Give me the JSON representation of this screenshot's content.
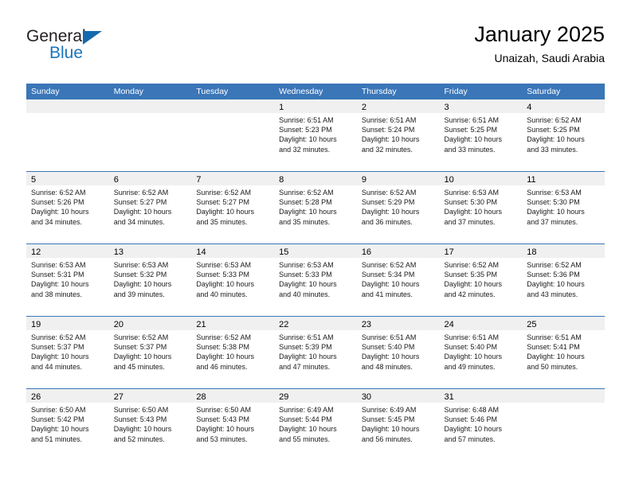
{
  "brand": {
    "name_top": "General",
    "name_bottom": "Blue",
    "triangle_color": "#156aad",
    "blue_color": "#1b75bb"
  },
  "header": {
    "title": "January 2025",
    "subtitle": "Unaizah, Saudi Arabia"
  },
  "colors": {
    "header_row": "#3A76B8",
    "daynum_band": "#f0f0f0",
    "text": "#000000"
  },
  "weekday_headers": [
    "Sunday",
    "Monday",
    "Tuesday",
    "Wednesday",
    "Thursday",
    "Friday",
    "Saturday"
  ],
  "labels": {
    "sunrise_prefix": "Sunrise:",
    "sunset_prefix": "Sunset:",
    "daylight_prefix": "Daylight:"
  },
  "weeks": [
    [
      {
        "day": "",
        "empty": true,
        "sunrise": "",
        "sunset": "",
        "daylight_line1": "",
        "daylight_line2": ""
      },
      {
        "day": "",
        "empty": true,
        "sunrise": "",
        "sunset": "",
        "daylight_line1": "",
        "daylight_line2": ""
      },
      {
        "day": "",
        "empty": true,
        "sunrise": "",
        "sunset": "",
        "daylight_line1": "",
        "daylight_line2": ""
      },
      {
        "day": "1",
        "empty": false,
        "sunrise": "Sunrise: 6:51 AM",
        "sunset": "Sunset: 5:23 PM",
        "daylight_line1": "Daylight: 10 hours",
        "daylight_line2": "and 32 minutes."
      },
      {
        "day": "2",
        "empty": false,
        "sunrise": "Sunrise: 6:51 AM",
        "sunset": "Sunset: 5:24 PM",
        "daylight_line1": "Daylight: 10 hours",
        "daylight_line2": "and 32 minutes."
      },
      {
        "day": "3",
        "empty": false,
        "sunrise": "Sunrise: 6:51 AM",
        "sunset": "Sunset: 5:25 PM",
        "daylight_line1": "Daylight: 10 hours",
        "daylight_line2": "and 33 minutes."
      },
      {
        "day": "4",
        "empty": false,
        "sunrise": "Sunrise: 6:52 AM",
        "sunset": "Sunset: 5:25 PM",
        "daylight_line1": "Daylight: 10 hours",
        "daylight_line2": "and 33 minutes."
      }
    ],
    [
      {
        "day": "5",
        "empty": false,
        "sunrise": "Sunrise: 6:52 AM",
        "sunset": "Sunset: 5:26 PM",
        "daylight_line1": "Daylight: 10 hours",
        "daylight_line2": "and 34 minutes."
      },
      {
        "day": "6",
        "empty": false,
        "sunrise": "Sunrise: 6:52 AM",
        "sunset": "Sunset: 5:27 PM",
        "daylight_line1": "Daylight: 10 hours",
        "daylight_line2": "and 34 minutes."
      },
      {
        "day": "7",
        "empty": false,
        "sunrise": "Sunrise: 6:52 AM",
        "sunset": "Sunset: 5:27 PM",
        "daylight_line1": "Daylight: 10 hours",
        "daylight_line2": "and 35 minutes."
      },
      {
        "day": "8",
        "empty": false,
        "sunrise": "Sunrise: 6:52 AM",
        "sunset": "Sunset: 5:28 PM",
        "daylight_line1": "Daylight: 10 hours",
        "daylight_line2": "and 35 minutes."
      },
      {
        "day": "9",
        "empty": false,
        "sunrise": "Sunrise: 6:52 AM",
        "sunset": "Sunset: 5:29 PM",
        "daylight_line1": "Daylight: 10 hours",
        "daylight_line2": "and 36 minutes."
      },
      {
        "day": "10",
        "empty": false,
        "sunrise": "Sunrise: 6:53 AM",
        "sunset": "Sunset: 5:30 PM",
        "daylight_line1": "Daylight: 10 hours",
        "daylight_line2": "and 37 minutes."
      },
      {
        "day": "11",
        "empty": false,
        "sunrise": "Sunrise: 6:53 AM",
        "sunset": "Sunset: 5:30 PM",
        "daylight_line1": "Daylight: 10 hours",
        "daylight_line2": "and 37 minutes."
      }
    ],
    [
      {
        "day": "12",
        "empty": false,
        "sunrise": "Sunrise: 6:53 AM",
        "sunset": "Sunset: 5:31 PM",
        "daylight_line1": "Daylight: 10 hours",
        "daylight_line2": "and 38 minutes."
      },
      {
        "day": "13",
        "empty": false,
        "sunrise": "Sunrise: 6:53 AM",
        "sunset": "Sunset: 5:32 PM",
        "daylight_line1": "Daylight: 10 hours",
        "daylight_line2": "and 39 minutes."
      },
      {
        "day": "14",
        "empty": false,
        "sunrise": "Sunrise: 6:53 AM",
        "sunset": "Sunset: 5:33 PM",
        "daylight_line1": "Daylight: 10 hours",
        "daylight_line2": "and 40 minutes."
      },
      {
        "day": "15",
        "empty": false,
        "sunrise": "Sunrise: 6:53 AM",
        "sunset": "Sunset: 5:33 PM",
        "daylight_line1": "Daylight: 10 hours",
        "daylight_line2": "and 40 minutes."
      },
      {
        "day": "16",
        "empty": false,
        "sunrise": "Sunrise: 6:52 AM",
        "sunset": "Sunset: 5:34 PM",
        "daylight_line1": "Daylight: 10 hours",
        "daylight_line2": "and 41 minutes."
      },
      {
        "day": "17",
        "empty": false,
        "sunrise": "Sunrise: 6:52 AM",
        "sunset": "Sunset: 5:35 PM",
        "daylight_line1": "Daylight: 10 hours",
        "daylight_line2": "and 42 minutes."
      },
      {
        "day": "18",
        "empty": false,
        "sunrise": "Sunrise: 6:52 AM",
        "sunset": "Sunset: 5:36 PM",
        "daylight_line1": "Daylight: 10 hours",
        "daylight_line2": "and 43 minutes."
      }
    ],
    [
      {
        "day": "19",
        "empty": false,
        "sunrise": "Sunrise: 6:52 AM",
        "sunset": "Sunset: 5:37 PM",
        "daylight_line1": "Daylight: 10 hours",
        "daylight_line2": "and 44 minutes."
      },
      {
        "day": "20",
        "empty": false,
        "sunrise": "Sunrise: 6:52 AM",
        "sunset": "Sunset: 5:37 PM",
        "daylight_line1": "Daylight: 10 hours",
        "daylight_line2": "and 45 minutes."
      },
      {
        "day": "21",
        "empty": false,
        "sunrise": "Sunrise: 6:52 AM",
        "sunset": "Sunset: 5:38 PM",
        "daylight_line1": "Daylight: 10 hours",
        "daylight_line2": "and 46 minutes."
      },
      {
        "day": "22",
        "empty": false,
        "sunrise": "Sunrise: 6:51 AM",
        "sunset": "Sunset: 5:39 PM",
        "daylight_line1": "Daylight: 10 hours",
        "daylight_line2": "and 47 minutes."
      },
      {
        "day": "23",
        "empty": false,
        "sunrise": "Sunrise: 6:51 AM",
        "sunset": "Sunset: 5:40 PM",
        "daylight_line1": "Daylight: 10 hours",
        "daylight_line2": "and 48 minutes."
      },
      {
        "day": "24",
        "empty": false,
        "sunrise": "Sunrise: 6:51 AM",
        "sunset": "Sunset: 5:40 PM",
        "daylight_line1": "Daylight: 10 hours",
        "daylight_line2": "and 49 minutes."
      },
      {
        "day": "25",
        "empty": false,
        "sunrise": "Sunrise: 6:51 AM",
        "sunset": "Sunset: 5:41 PM",
        "daylight_line1": "Daylight: 10 hours",
        "daylight_line2": "and 50 minutes."
      }
    ],
    [
      {
        "day": "26",
        "empty": false,
        "sunrise": "Sunrise: 6:50 AM",
        "sunset": "Sunset: 5:42 PM",
        "daylight_line1": "Daylight: 10 hours",
        "daylight_line2": "and 51 minutes."
      },
      {
        "day": "27",
        "empty": false,
        "sunrise": "Sunrise: 6:50 AM",
        "sunset": "Sunset: 5:43 PM",
        "daylight_line1": "Daylight: 10 hours",
        "daylight_line2": "and 52 minutes."
      },
      {
        "day": "28",
        "empty": false,
        "sunrise": "Sunrise: 6:50 AM",
        "sunset": "Sunset: 5:43 PM",
        "daylight_line1": "Daylight: 10 hours",
        "daylight_line2": "and 53 minutes."
      },
      {
        "day": "29",
        "empty": false,
        "sunrise": "Sunrise: 6:49 AM",
        "sunset": "Sunset: 5:44 PM",
        "daylight_line1": "Daylight: 10 hours",
        "daylight_line2": "and 55 minutes."
      },
      {
        "day": "30",
        "empty": false,
        "sunrise": "Sunrise: 6:49 AM",
        "sunset": "Sunset: 5:45 PM",
        "daylight_line1": "Daylight: 10 hours",
        "daylight_line2": "and 56 minutes."
      },
      {
        "day": "31",
        "empty": false,
        "sunrise": "Sunrise: 6:48 AM",
        "sunset": "Sunset: 5:46 PM",
        "daylight_line1": "Daylight: 10 hours",
        "daylight_line2": "and 57 minutes."
      },
      {
        "day": "",
        "empty": true,
        "sunrise": "",
        "sunset": "",
        "daylight_line1": "",
        "daylight_line2": ""
      }
    ]
  ]
}
